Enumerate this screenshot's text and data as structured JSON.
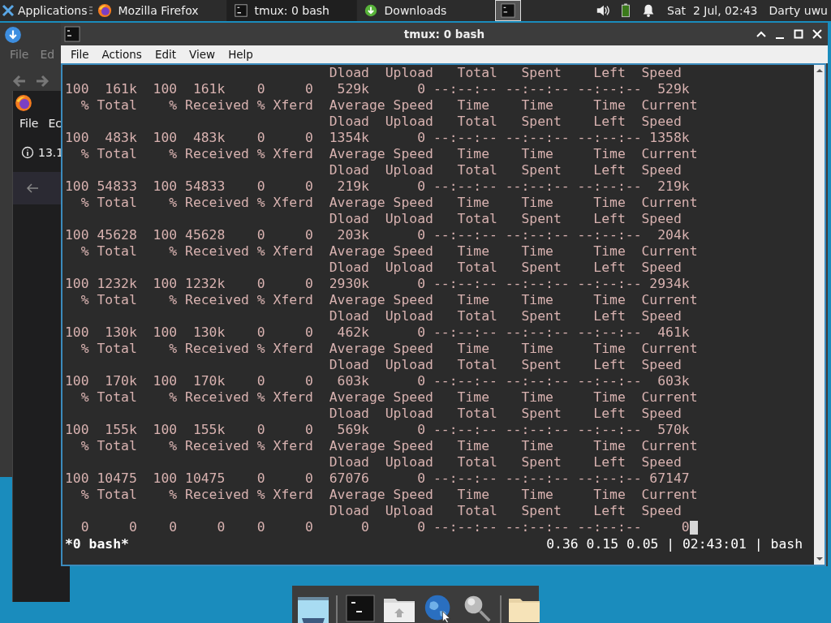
{
  "top_panel": {
    "applications": "Applications",
    "tasks": [
      {
        "label": "Mozilla Firefox",
        "kind": "browser",
        "selected": false
      },
      {
        "label": "tmux: 0 bash",
        "kind": "terminal",
        "selected": true
      },
      {
        "label": "Downloads",
        "kind": "downloads",
        "selected": false
      }
    ],
    "clock": "Sat  2 Jul, 02:43",
    "user": "Darty uwu"
  },
  "background_windows": [
    {
      "menu": [
        "File",
        "Ed"
      ]
    },
    {
      "menu": [
        "File",
        "Ec"
      ],
      "info": "13.1"
    }
  ],
  "window": {
    "title": "tmux: 0 bash",
    "menu": [
      "File",
      "Actions",
      "Edit",
      "View",
      "Help"
    ],
    "terminal_lines": [
      "                                 Dload  Upload   Total   Spent    Left  Speed",
      "100  161k  100  161k    0     0   529k      0 --:--:-- --:--:-- --:--:--  529k",
      "  % Total    % Received % Xferd  Average Speed   Time    Time     Time  Current",
      "                                 Dload  Upload   Total   Spent    Left  Speed",
      "100  483k  100  483k    0     0  1354k      0 --:--:-- --:--:-- --:--:-- 1358k",
      "  % Total    % Received % Xferd  Average Speed   Time    Time     Time  Current",
      "                                 Dload  Upload   Total   Spent    Left  Speed",
      "100 54833  100 54833    0     0   219k      0 --:--:-- --:--:-- --:--:--  219k",
      "  % Total    % Received % Xferd  Average Speed   Time    Time     Time  Current",
      "                                 Dload  Upload   Total   Spent    Left  Speed",
      "100 45628  100 45628    0     0   203k      0 --:--:-- --:--:-- --:--:--  204k",
      "  % Total    % Received % Xferd  Average Speed   Time    Time     Time  Current",
      "                                 Dload  Upload   Total   Spent    Left  Speed",
      "100 1232k  100 1232k    0     0  2930k      0 --:--:-- --:--:-- --:--:-- 2934k",
      "  % Total    % Received % Xferd  Average Speed   Time    Time     Time  Current",
      "                                 Dload  Upload   Total   Spent    Left  Speed",
      "100  130k  100  130k    0     0   462k      0 --:--:-- --:--:-- --:--:--  461k",
      "  % Total    % Received % Xferd  Average Speed   Time    Time     Time  Current",
      "                                 Dload  Upload   Total   Spent    Left  Speed",
      "100  170k  100  170k    0     0   603k      0 --:--:-- --:--:-- --:--:--  603k",
      "  % Total    % Received % Xferd  Average Speed   Time    Time     Time  Current",
      "                                 Dload  Upload   Total   Spent    Left  Speed",
      "100  155k  100  155k    0     0   569k      0 --:--:-- --:--:-- --:--:--  570k",
      "  % Total    % Received % Xferd  Average Speed   Time    Time     Time  Current",
      "                                 Dload  Upload   Total   Spent    Left  Speed",
      "100 10475  100 10475    0     0  67076      0 --:--:-- --:--:-- --:--:-- 67147",
      "  % Total    % Received % Xferd  Average Speed   Time    Time     Time  Current",
      "                                 Dload  Upload   Total   Spent    Left  Speed",
      "  0     0    0     0    0     0      0      0 --:--:-- --:--:-- --:--:--     0"
    ],
    "status_left": "*0 bash*",
    "status_right": "0.36 0.15 0.05 | 02:43:01 | bash"
  }
}
